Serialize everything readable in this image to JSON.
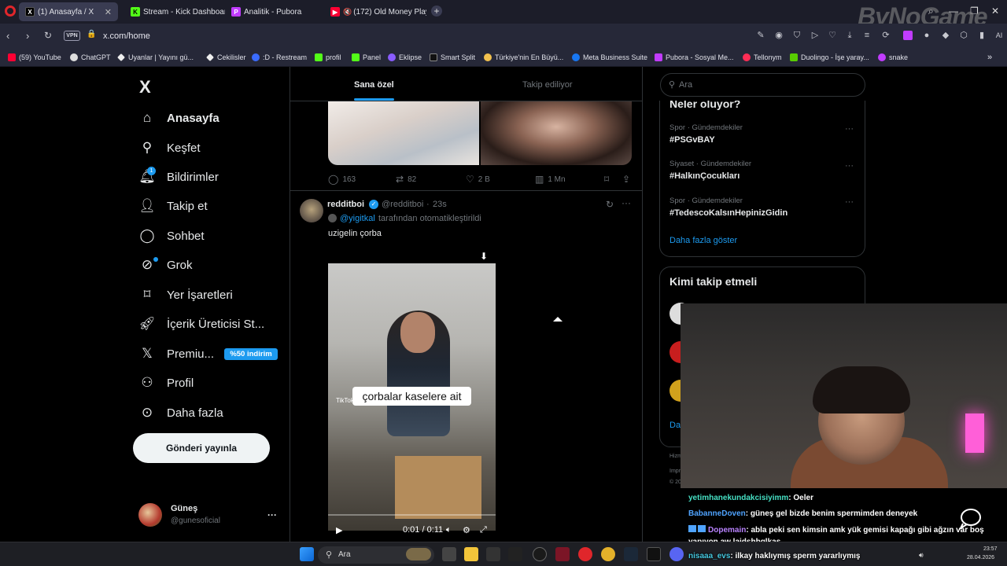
{
  "browser": {
    "tabs": [
      {
        "label": "(1) Anasayfa / X",
        "active": true
      },
      {
        "label": "Stream - Kick Dashboard",
        "active": false
      },
      {
        "label": "Analitik - Pubora",
        "active": false
      },
      {
        "label": "(172) Old Money Playl",
        "active": false
      }
    ],
    "url": "x.com/home",
    "vpn_label": "VPN",
    "ai_label": "AI",
    "bookmarks": [
      "(59) YouTube",
      "ChatGPT",
      "Uyanlar | Yayını gü...",
      "Cekilisler",
      ":D - Restream",
      "profil",
      "Panel",
      "Eklipse",
      "Smart Split",
      "Türkiye'nin En Büyü...",
      "Meta Business Suite",
      "Pubora - Sosyal Me...",
      "Tellonym",
      "Duolingo - İşe yaray...",
      "snake"
    ]
  },
  "watermark": "ByNoGame",
  "sidebar": {
    "logo": "X",
    "items": [
      {
        "label": "Anasayfa",
        "icon": "home-icon"
      },
      {
        "label": "Keşfet",
        "icon": "search-icon"
      },
      {
        "label": "Bildirimler",
        "icon": "bell-icon",
        "badge": "1"
      },
      {
        "label": "Takip et",
        "icon": "add-person-icon"
      },
      {
        "label": "Sohbet",
        "icon": "chat-icon"
      },
      {
        "label": "Grok",
        "icon": "grok-icon"
      },
      {
        "label": "Yer İşaretleri",
        "icon": "bookmark-icon"
      },
      {
        "label": "İçerik Üreticisi St...",
        "icon": "rocket-icon"
      },
      {
        "label": "Premiu...",
        "icon": "x-icon",
        "promo": "%50 indirim"
      },
      {
        "label": "Profil",
        "icon": "person-icon"
      },
      {
        "label": "Daha fazla",
        "icon": "more-circle-icon"
      }
    ],
    "post_button": "Gönderi yayınla",
    "account": {
      "name": "Güneş",
      "handle": "@gunesoficial",
      "more": "···"
    }
  },
  "feed": {
    "tabs": [
      "Sana özel",
      "Takip ediliyor"
    ],
    "prev_tweet_actions": {
      "replies": "163",
      "retweets": "82",
      "likes": "2 B",
      "views": "1 Mn"
    },
    "tweet": {
      "name": "redditboi",
      "handle": "@redditboi",
      "time": "23s",
      "auto_by": "@yigitkal",
      "auto_text": "tarafından otomatikleştirildi",
      "text": "uzigelin çorba",
      "video_caption": "çorbalar kaselere ait",
      "video_time": "0:01 / 0:11",
      "tiktok_label": "TikTok"
    }
  },
  "right": {
    "search_placeholder": "Ara",
    "trends_title": "Neler oluyor?",
    "trends": [
      {
        "meta": "Spor · Gündemdekiler",
        "tag": "#PSGvBAY"
      },
      {
        "meta": "Siyaset · Gündemdekiler",
        "tag": "#HalkınÇocukları"
      },
      {
        "meta": "Spor · Gündemdekiler",
        "tag": "#TedescoKalsınHepinizGidin"
      }
    ],
    "more_link": "Daha fazla göster",
    "who_to_follow": "Kimi takip etmeli",
    "partial_texts": [
      "Da",
      "Hizm",
      "Impri",
      "© 202"
    ]
  },
  "chat": [
    {
      "user": "yetimhanekundakcisiyimm",
      "color": "#46e0c4",
      "msg": ": Oeler"
    },
    {
      "user": "BabanneDoven",
      "color": "#4fa3ff",
      "msg": ": güneş gel bizde benim spermimden deneyek"
    },
    {
      "user": "Dopemain",
      "color": "#b983ff",
      "msg": ": abla peki sen kimsin amk yük gemisi kapağı gibi ağzın var boş"
    },
    {
      "user": "",
      "color": "#ffffff",
      "msg": "yapıyon aw lajdshbglkas"
    },
    {
      "user": "nisaaa_evs",
      "color": "#46c8e0",
      "msg": ": ilkay haklıymış sperm yararlıymış"
    }
  ],
  "taskbar": {
    "search": "Ara",
    "time": "23:57",
    "date": "28.04.2026"
  }
}
